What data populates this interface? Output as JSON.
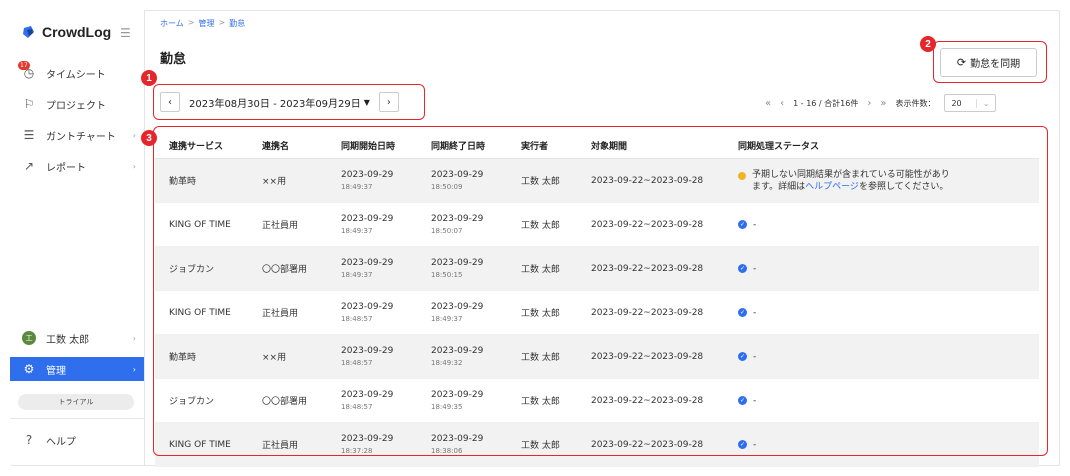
{
  "sidebar": {
    "logo_text": "CrowdLog",
    "notif_count": "17",
    "items": [
      {
        "label": "タイムシート"
      },
      {
        "label": "プロジェクト"
      },
      {
        "label": "ガントチャート"
      },
      {
        "label": "レポート"
      }
    ],
    "user": {
      "initial": "工",
      "name": "工数 太郎"
    },
    "admin_label": "管理",
    "trial_label": "トライアル",
    "help_label": "ヘルプ"
  },
  "breadcrumb": [
    "ホーム",
    "管理",
    "勤怠"
  ],
  "breadcrumb_sep": ">",
  "page_title": "勤怠",
  "sync_button_label": "勤怠を同期",
  "date_range": "2023年08月30日 - 2023年09月29日",
  "pager": {
    "range": "1 - 16 / 合計16件",
    "per_page_label": "表示件数：",
    "per_page": "20"
  },
  "table": {
    "headers": [
      "連携サービス",
      "連携名",
      "同期開始日時",
      "同期終了日時",
      "実行者",
      "対象期間",
      "同期処理ステータス"
    ],
    "rows": [
      {
        "service": "勤革時",
        "name": "××用",
        "start_date": "2023-09-29",
        "start_time": "18:49:37",
        "end_date": "2023-09-29",
        "end_time": "18:50:09",
        "user": "工数 太郎",
        "period": "2023-09-22~2023-09-28",
        "status": "warn",
        "msg1": "予期しない同期結果が含まれている可能性があり",
        "msg2a": "ます。詳細は",
        "msg2link": "ヘルプページ",
        "msg2b": "を参照してください。"
      },
      {
        "service": "KING OF TIME",
        "name": "正社員用",
        "start_date": "2023-09-29",
        "start_time": "18:49:37",
        "end_date": "2023-09-29",
        "end_time": "18:50:07",
        "user": "工数 太郎",
        "period": "2023-09-22~2023-09-28",
        "status": "ok",
        "msg1": "-"
      },
      {
        "service": "ジョブカン",
        "name": "〇〇部署用",
        "start_date": "2023-09-29",
        "start_time": "18:49:37",
        "end_date": "2023-09-29",
        "end_time": "18:50:15",
        "user": "工数 太郎",
        "period": "2023-09-22~2023-09-28",
        "status": "ok",
        "msg1": "-"
      },
      {
        "service": "KING OF TIME",
        "name": "正社員用",
        "start_date": "2023-09-29",
        "start_time": "18:48:57",
        "end_date": "2023-09-29",
        "end_time": "18:49:37",
        "user": "工数 太郎",
        "period": "2023-09-22~2023-09-28",
        "status": "ok",
        "msg1": "-"
      },
      {
        "service": "勤革時",
        "name": "××用",
        "start_date": "2023-09-29",
        "start_time": "18:48:57",
        "end_date": "2023-09-29",
        "end_time": "18:49:32",
        "user": "工数 太郎",
        "period": "2023-09-22~2023-09-28",
        "status": "ok",
        "msg1": "-"
      },
      {
        "service": "ジョブカン",
        "name": "〇〇部署用",
        "start_date": "2023-09-29",
        "start_time": "18:48:57",
        "end_date": "2023-09-29",
        "end_time": "18:49:35",
        "user": "工数 太郎",
        "period": "2023-09-22~2023-09-28",
        "status": "ok",
        "msg1": "-"
      },
      {
        "service": "KING OF TIME",
        "name": "正社員用",
        "start_date": "2023-09-29",
        "start_time": "18:37:28",
        "end_date": "2023-09-29",
        "end_time": "18:38:06",
        "user": "工数 太郎",
        "period": "2023-09-22~2023-09-28",
        "status": "ok",
        "msg1": "-"
      }
    ]
  },
  "callouts": [
    "1",
    "2",
    "3"
  ],
  "colors": {
    "accent": "#2f6fed",
    "callout": "#e5262b",
    "warn": "#f0b429"
  }
}
